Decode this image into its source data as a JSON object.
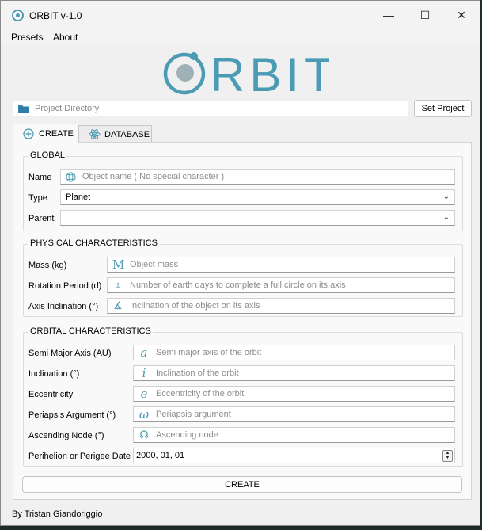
{
  "window": {
    "title": "ORBIT v-1.0",
    "minimize": "—",
    "maximize": "☐",
    "close": "✕"
  },
  "menu": [
    "Presets",
    "About"
  ],
  "logo": {
    "text": "ORBIT",
    "color": "#4a9bb3"
  },
  "project": {
    "placeholder": "Project Directory",
    "set_button": "Set Project"
  },
  "tabs": [
    {
      "label": "CREATE",
      "icon": "plus-circle-icon"
    },
    {
      "label": "DATABASE",
      "icon": "atom-icon"
    }
  ],
  "global": {
    "title": "GLOBAL",
    "name_label": "Name",
    "name_placeholder": "Object name ( No special character )",
    "type_label": "Type",
    "type_value": "Planet",
    "parent_label": "Parent",
    "parent_value": ""
  },
  "physical": {
    "title": "PHYSICAL CHARACTERISTICS",
    "mass_label": "Mass (kg)",
    "mass_icon": "M",
    "mass_placeholder": "Object mass",
    "rotation_label": "Rotation Period (d)",
    "rotation_icon": "⌽",
    "rotation_placeholder": "Number of earth days to complete a full circle on its axis",
    "axis_label": "Axis Inclination (°)",
    "axis_icon": "∡",
    "axis_placeholder": "Inclination of the object on its axis"
  },
  "orbital": {
    "title": "ORBITAL CHARACTERISTICS",
    "sma_label": "Semi Major Axis (AU)",
    "sma_icon": "a",
    "sma_placeholder": "Semi major axis of the orbit",
    "incl_label": "Inclination (°)",
    "incl_icon": "i",
    "incl_placeholder": "Inclination of the orbit",
    "ecc_label": "Eccentricity",
    "ecc_icon": "e",
    "ecc_placeholder": "Eccentricity of the orbit",
    "peri_label": "Periapsis Argument (°)",
    "peri_icon": "ω",
    "peri_placeholder": "Periapsis argument",
    "node_label": "Ascending Node (°)",
    "node_icon": "☊",
    "node_placeholder": "Ascending node",
    "date_label": "Perihelion or Perigee Date",
    "date_value": "2000, 01, 01"
  },
  "create_button": "CREATE",
  "footer": "By Tristan Giandoriggio"
}
